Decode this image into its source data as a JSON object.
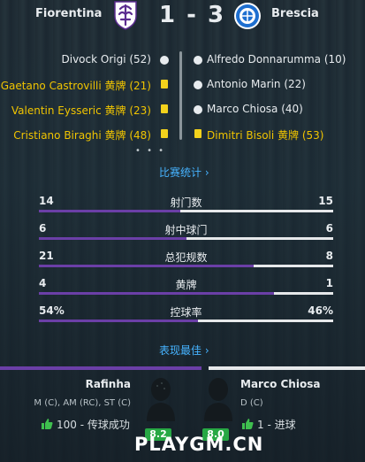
{
  "match": {
    "home_team": "Fiorentina",
    "away_team": "Brescia",
    "score": "1 - 3"
  },
  "events": {
    "home": [
      {
        "text": "Divock Origi (52)",
        "type": "goal"
      },
      {
        "text": "Gaetano Castrovilli 黄牌 (21)",
        "type": "yellow"
      },
      {
        "text": "Valentin Eysseric 黄牌 (23)",
        "type": "yellow"
      },
      {
        "text": "Cristiano Biraghi 黄牌 (48)",
        "type": "yellow"
      }
    ],
    "away": [
      {
        "text": "Alfredo Donnarumma (10)",
        "type": "goal"
      },
      {
        "text": "Antonio Marin (22)",
        "type": "goal"
      },
      {
        "text": "Marco Chiosa (40)",
        "type": "goal"
      },
      {
        "text": "Dimitri Bisoli 黄牌 (53)",
        "type": "yellow"
      }
    ],
    "more": "• • •"
  },
  "stats_link": "比赛统计 ›",
  "stats": [
    {
      "label": "射门数",
      "home": "14",
      "away": "15",
      "home_share": 0.48
    },
    {
      "label": "射中球门",
      "home": "6",
      "away": "6",
      "home_share": 0.5
    },
    {
      "label": "总犯规数",
      "home": "21",
      "away": "8",
      "home_share": 0.73
    },
    {
      "label": "黄牌",
      "home": "4",
      "away": "1",
      "home_share": 0.8
    },
    {
      "label": "控球率",
      "home": "54%",
      "away": "46%",
      "home_share": 0.54
    }
  ],
  "top_players_link": "表现最佳 ›",
  "top_players": {
    "home": {
      "name": "Rafinha",
      "positions": "M (C), AM (RC), ST (C)",
      "stat": "100 - 传球成功",
      "rating": "8.2"
    },
    "away": {
      "name": "Marco Chiosa",
      "positions": "D (C)",
      "stat": "1 - 进球",
      "rating": "8.0"
    }
  },
  "watermark": "PLAYGM.CN",
  "colors": {
    "accent_purple": "#6b3fa7",
    "link_blue": "#46b3ff",
    "yellow_card": "#f3d21c",
    "rating_green": "#27a844"
  }
}
